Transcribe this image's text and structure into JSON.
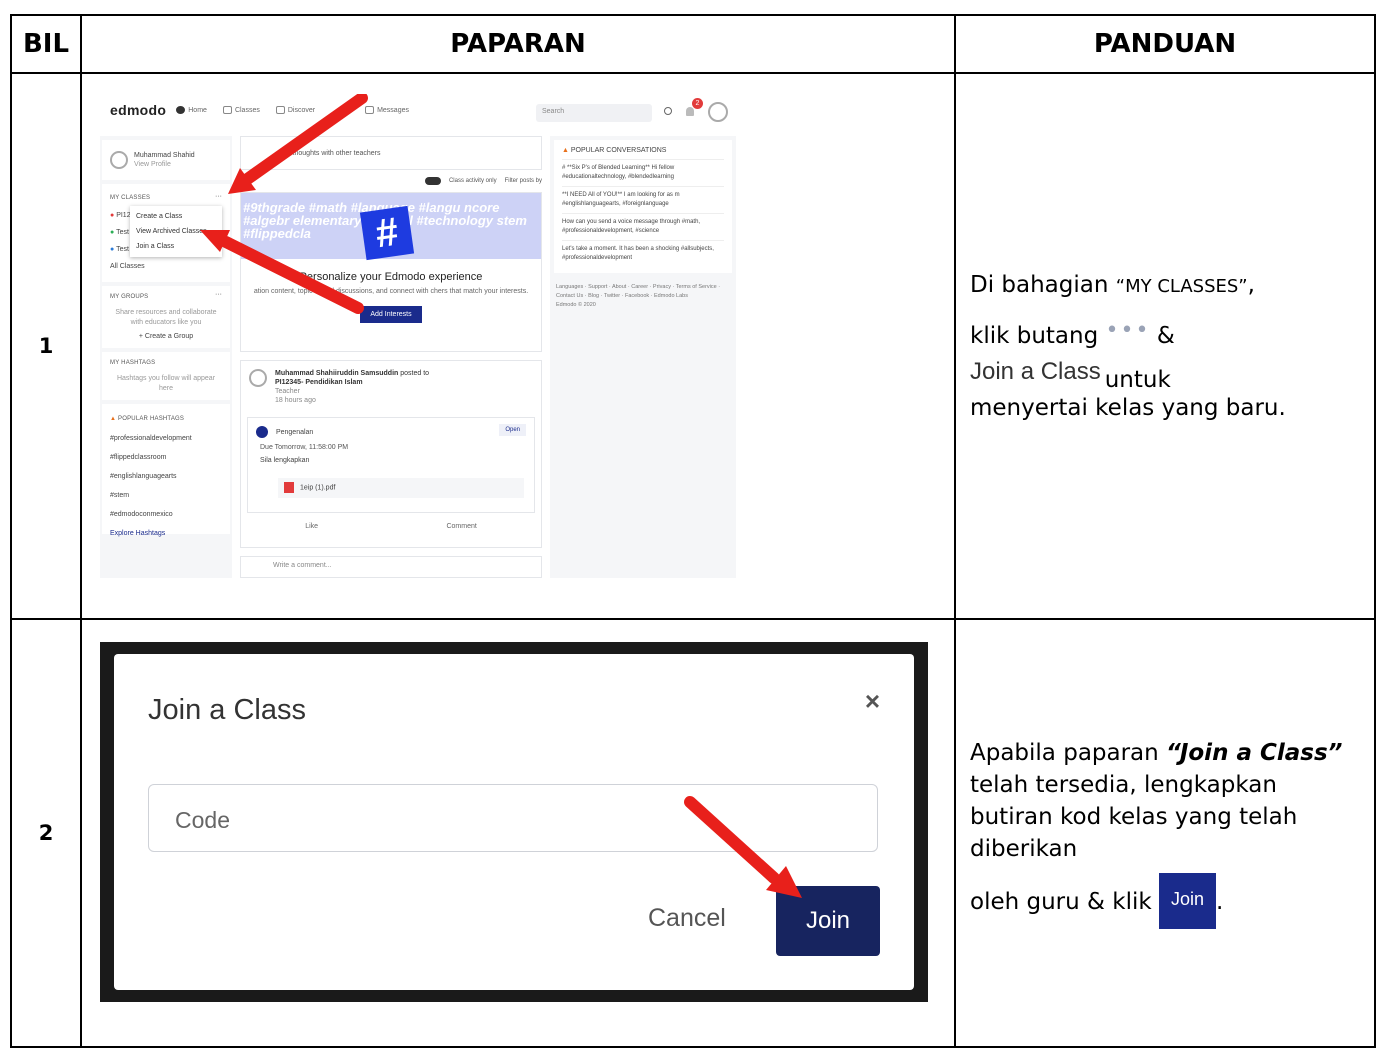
{
  "headers": {
    "bil": "BIL",
    "paparan": "PAPARAN",
    "panduan": "PANDUAN"
  },
  "rows": [
    {
      "num": "1",
      "panduan": {
        "p1_prefix": "Di bahagian ",
        "p1_quote": "“MY CLASSES”",
        "p1_suffix": ",",
        "p2_prefix": "klik butang",
        "p2_amp": "&",
        "p2_button": "Join a Class",
        "p3": "untuk",
        "p4": "menyertai kelas yang baru."
      }
    },
    {
      "num": "2",
      "panduan": {
        "p1": "Apabila paparan ",
        "p1_em": "“Join a Class”",
        "p2": " telah tersedia, lengkapkan butiran kod kelas yang telah diberikan",
        "p3": "oleh guru & klik",
        "p3_button": "Join",
        "p3_end": "."
      }
    }
  ],
  "edmodo": {
    "logo": "edmodo",
    "nav": [
      "Home",
      "Classes",
      "Discover",
      "Messages"
    ],
    "search_placeholder": "Search",
    "notif_count": "2",
    "profile_name": "Muhammad Shahid",
    "profile_link": "View Profile",
    "my_classes_label": "MY CLASSES",
    "class_items": [
      "PI12",
      "Test",
      "Test"
    ],
    "menu_items": [
      "Create a Class",
      "View Archived Classes",
      "Join a Class"
    ],
    "all_classes": "All Classes",
    "my_groups_label": "MY GROUPS",
    "groups_text": "Share resources and collaborate with educators like you",
    "create_group": "+ Create a Group",
    "my_hashtags_label": "MY HASHTAGS",
    "hashtags_text": "Hashtags you follow will appear here",
    "popular_hashtags_label": "POPULAR HASHTAGS",
    "popular_hashtags": [
      "#professionaldevelopment",
      "#flippedclassroom",
      "#englishlanguagearts",
      "#stem",
      "#edmodoconmexico"
    ],
    "explore_hashtags": "Explore Hashtags",
    "share_text": "your thoughts with other teachers",
    "class_activity": "Class activity only",
    "filter": "Filter posts by",
    "banner_tags": "#9thgrade #math  #language #langu ncore #algebr   elementary #ste vel #technology  stem #flippedcla",
    "banner_title": "Personalize your Edmodo experience",
    "banner_sub": "ation content, topic-based discussions, and connect with chers that match your interests.",
    "add_interests": "Add Interests",
    "post_author": "Muhammad Shahiiruddin Samsuddin",
    "post_verb": "posted to",
    "post_class": "PI12345- Pendidikan Islam",
    "post_role": "Teacher",
    "post_time": "18 hours ago",
    "assign_title": "Pengenalan",
    "assign_due": "Due Tomorrow, 11:58:00 PM",
    "assign_note": "Sila lengkapkan",
    "assign_file": "1eip (1).pdf",
    "open": "Open",
    "like": "Like",
    "comment": "Comment",
    "write_comment": "Write a comment...",
    "popular_conv_label": "POPULAR CONVERSATIONS",
    "conversations": [
      "# **Six P's of Blended Learning** Hi fellow #educationaltechnology, #blendedlearning",
      "**I NEED All of YOU!** I am looking for as m #englishlanguagearts, #foreignlanguage",
      "How can you send a voice message through #math, #professionaldevelopment, #science",
      "Let's take a moment. It has been a shocking #allsubjects, #professionaldevelopment"
    ],
    "footer": "Languages · Support · About · Career · Privacy · Terms of Service · Contact Us · Blog · Twitter · Facebook · Edmodo Labs",
    "copyright": "Edmodo © 2020"
  },
  "dialog": {
    "title": "Join a Class",
    "close": "×",
    "code_placeholder": "Code",
    "cancel": "Cancel",
    "join": "Join"
  },
  "colors": {
    "arrow": "#e8201b",
    "join_button": "#17245f",
    "edmodo_primary": "#1a2b8c"
  }
}
